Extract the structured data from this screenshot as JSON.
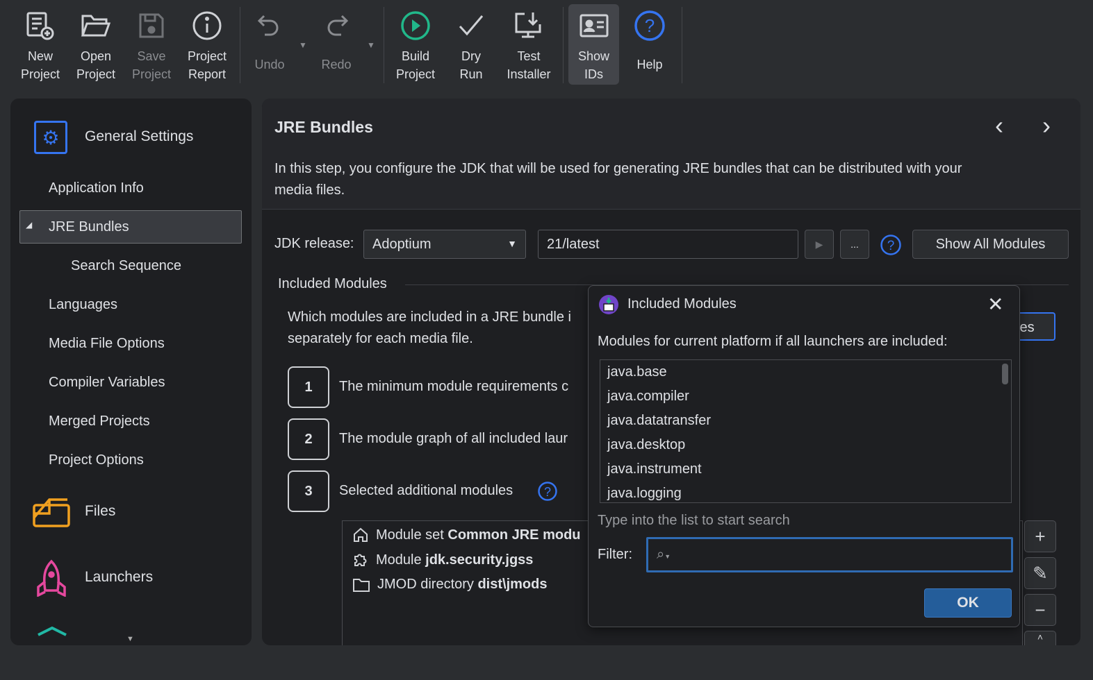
{
  "toolbar": {
    "new_project": "New\nProject",
    "open_project": "Open\nProject",
    "save_project": "Save\nProject",
    "project_report": "Project\nReport",
    "undo": "Undo",
    "redo": "Redo",
    "build_project": "Build\nProject",
    "dry_run": "Dry\nRun",
    "test_installer": "Test\nInstaller",
    "show_ids": "Show\nIDs",
    "help": "Help"
  },
  "sidebar": {
    "general_settings": "General Settings",
    "items": [
      {
        "label": "Application Info"
      },
      {
        "label": "JRE Bundles"
      },
      {
        "label": "Search Sequence"
      },
      {
        "label": "Languages"
      },
      {
        "label": "Media File Options"
      },
      {
        "label": "Compiler Variables"
      },
      {
        "label": "Merged Projects"
      },
      {
        "label": "Project Options"
      }
    ],
    "files": "Files",
    "launchers": "Launchers"
  },
  "main": {
    "title": "JRE Bundles",
    "description": "In this step, you configure the JDK that will be used for generating JRE bundles that can be distributed with your media files.",
    "jdk_release_label": "JDK release:",
    "jdk_provider": "Adoptium",
    "jdk_version": "21/latest",
    "browse_label": "...",
    "show_all_modules": "Show All Modules",
    "included_modules_heading": "Included Modules",
    "included_desc_1": "Which modules are included in a JRE bundle i",
    "included_desc_2": "separately for each media file.",
    "hidden_button_fragment": "les",
    "steps": [
      {
        "num": "1",
        "text": "The minimum module requirements c"
      },
      {
        "num": "2",
        "text": "The module graph of all included laur"
      },
      {
        "num": "3",
        "text": "Selected additional modules"
      }
    ],
    "module_entries": [
      {
        "prefix": "Module set ",
        "value": "Common JRE modu",
        "icon": "home-icon"
      },
      {
        "prefix": "Module ",
        "value": "jdk.security.jgss",
        "icon": "puzzle-icon"
      },
      {
        "prefix": "JMOD directory ",
        "value": "dist\\jmods",
        "icon": "folder-icon"
      }
    ]
  },
  "dialog": {
    "title": "Included Modules",
    "subtitle": "Modules for current platform if all launchers are included:",
    "modules": [
      "java.base",
      "java.compiler",
      "java.datatransfer",
      "java.desktop",
      "java.instrument",
      "java.logging"
    ],
    "search_hint": "Type into the list to start search",
    "filter_label": "Filter:",
    "filter_value": "",
    "ok": "OK"
  },
  "colors": {
    "accent": "#3574f0",
    "build_green": "#21b88a",
    "files_orange": "#f0a020",
    "launchers_pink": "#e5489e",
    "ok_button": "#245d9a"
  }
}
